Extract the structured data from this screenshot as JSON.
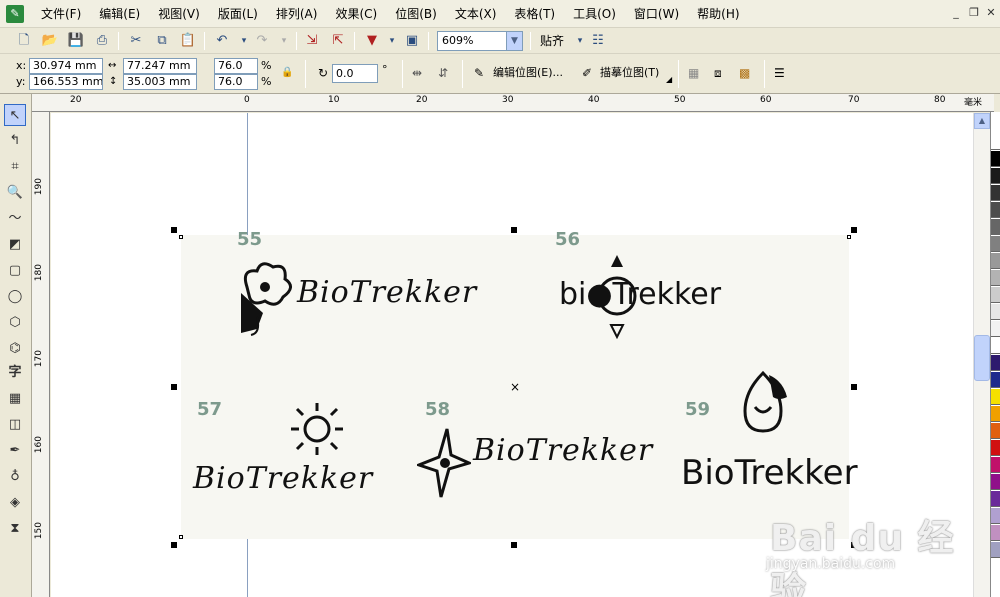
{
  "menu": {
    "items": [
      "文件(F)",
      "编辑(E)",
      "视图(V)",
      "版面(L)",
      "排列(A)",
      "效果(C)",
      "位图(B)",
      "文本(X)",
      "表格(T)",
      "工具(O)",
      "窗口(W)",
      "帮助(H)"
    ]
  },
  "toolbar": {
    "zoom": "609%",
    "snap_label": "贴齐"
  },
  "property_bar": {
    "x_label": "x:",
    "x_value": "30.974 mm",
    "y_label": "y:",
    "y_value": "166.553 mm",
    "width_value": "77.247 mm",
    "height_value": "35.003 mm",
    "scale_x": "76.0",
    "scale_y": "76.0",
    "percent": "%",
    "rotation": "0.0",
    "degree": "°",
    "edit_bitmap": "编辑位图(E)...",
    "trace_bitmap": "描摹位图(T)"
  },
  "ruler": {
    "unit": "毫米",
    "h_labels": [
      "20",
      "0",
      "10",
      "20",
      "30",
      "40",
      "50",
      "60",
      "70",
      "80"
    ],
    "v_labels": [
      "190",
      "180",
      "170",
      "160",
      "150"
    ]
  },
  "canvas": {
    "logos": [
      {
        "number": "55",
        "text": "BioTrekker"
      },
      {
        "number": "56",
        "text": "bi●Trekker"
      },
      {
        "number": "57",
        "text": "BioTrekker"
      },
      {
        "number": "58",
        "text": "BioTrekker"
      },
      {
        "number": "59",
        "text": "BioTrekker"
      }
    ]
  },
  "watermark": {
    "brand": "Bai du 经验",
    "url": "jingyan.baidu.com"
  },
  "colors": {
    "palette": [
      "#ffffff",
      "#000000",
      "#1a1a1a",
      "#333333",
      "#4d4d4d",
      "#666666",
      "#808080",
      "#999999",
      "#b3b3b3",
      "#cccccc",
      "#e6e6e6",
      "#f2f2f2",
      "#ffffff",
      "#2e1a6e",
      "#1e2a8c",
      "#f5e000",
      "#f0a000",
      "#e06010",
      "#d01010",
      "#c0106a",
      "#90108a",
      "#6a2a9a",
      "#b0a0d0",
      "#c090c0",
      "#a0a0c0"
    ]
  }
}
